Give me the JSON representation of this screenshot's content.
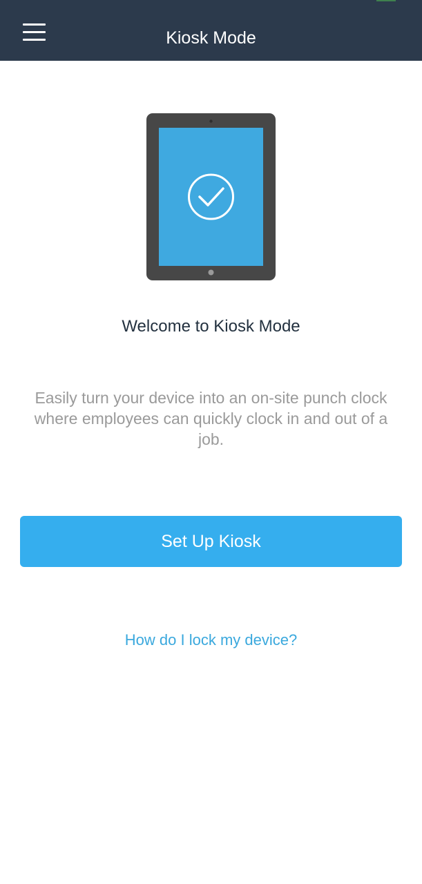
{
  "header": {
    "title": "Kiosk Mode",
    "menu_icon": "hamburger-menu-icon",
    "background": "#2c3a4c"
  },
  "illustration": {
    "icon": "tablet-checkmark-icon",
    "screen_color": "#3fa9e0",
    "frame_color": "#474747"
  },
  "main": {
    "title": "Welcome to Kiosk Mode",
    "description": "Easily turn your device into an on-site punch clock where employees can quickly clock in and out of a job.",
    "setup_button_label": "Set Up Kiosk",
    "help_link_label": "How do I lock my device?"
  },
  "colors": {
    "accent": "#35aeee",
    "link": "#3aa8dd",
    "title_text": "#23313f",
    "body_text": "#9a9a9a"
  }
}
